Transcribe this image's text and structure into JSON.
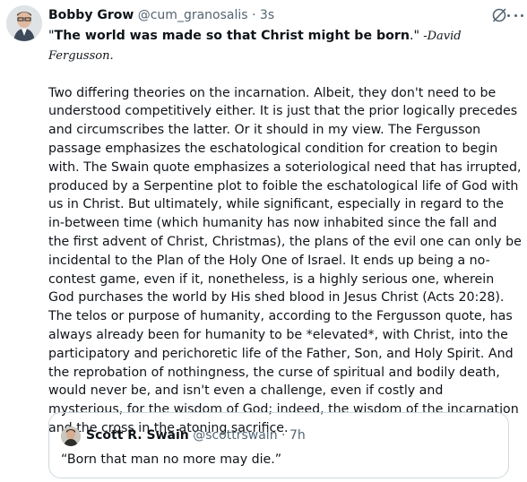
{
  "post": {
    "author_name": "Bobby Grow",
    "handle": "@cum_granosalis",
    "separator": "·",
    "time": "3s",
    "quote_open": "\"",
    "quote_text": "The world was made so that Christ might be born",
    "quote_close": ".\"",
    "attribution": " -David Fergusson.",
    "paragraph": "Two differing theories on the incarnation. Albeit, they don't need to be understood competitively either. It is just that the prior logically precedes and circumscribes the latter. Or it should in my view. The Fergusson passage emphasizes the eschatological condition for creation to begin with. The Swain quote emphasizes a soteriological need that has irrupted, produced by a Serpentine plot to foible the eschatological life of God with us in Christ. But ultimately, while significant, especially in regard to the in-between time (which humanity has now inhabited since the fall and the first advent of Christ, Christmas), the plans of the evil one can only be incidental to the Plan of the Holy One of Israel. It ends up being a no-contest game, even if it, nonetheless, is a highly serious one, wherein God purchases the world by His shed blood in Jesus Christ (Acts 20:28). The telos or purpose of humanity, according to the Fergusson quote, has always already been for humanity to be *elevated*, with Christ, into the participatory and perichoretic life of the Father, Son, and Holy Spirit. And the reprobation of nothingness, the curse of spiritual and bodily death, would never be, and isn't even a challenge, even if costly and mysterious, for the wisdom of God; indeed, the wisdom of the incarnation and the cross in the atoning sacrifice."
  },
  "quoted_post": {
    "author_name": "Scott R. Swain",
    "handle": "@scottrswain",
    "separator": "·",
    "time": "7h",
    "text": "“Born that man no more may die.”"
  },
  "icons": {
    "header_action": "edit-slash-icon",
    "more": "more-dots-icon"
  },
  "colors": {
    "text": "#0f1419",
    "muted": "#536471",
    "border": "#cfd9de"
  }
}
